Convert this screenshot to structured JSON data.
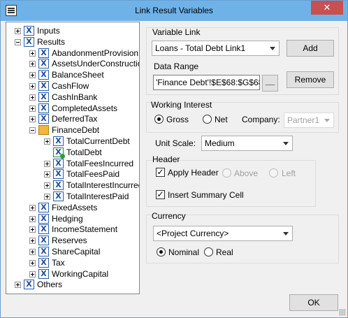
{
  "window": {
    "title": "Link Result Variables",
    "close_symbol": "✕"
  },
  "tree": [
    {
      "label": "Inputs",
      "icon": "variables-icon",
      "expander": "plus"
    },
    {
      "label": "Results",
      "icon": "variables-icon",
      "expander": "minus"
    },
    {
      "label": "AbandonmentProvision",
      "icon": "excel-icon",
      "expander": "plus"
    },
    {
      "label": "AssetsUnderConstruction",
      "icon": "excel-icon",
      "expander": "plus"
    },
    {
      "label": "BalanceSheet",
      "icon": "excel-icon",
      "expander": "plus"
    },
    {
      "label": "CashFlow",
      "icon": "excel-icon",
      "expander": "plus"
    },
    {
      "label": "CashInBank",
      "icon": "excel-icon",
      "expander": "plus"
    },
    {
      "label": "CompletedAssets",
      "icon": "excel-icon",
      "expander": "plus"
    },
    {
      "label": "DeferredTax",
      "icon": "excel-icon",
      "expander": "plus"
    },
    {
      "label": "FinanceDebt",
      "icon": "folder-icon",
      "expander": "minus"
    },
    {
      "label": "TotalCurrentDebt",
      "icon": "excel-icon",
      "expander": "plus"
    },
    {
      "label": "TotalDebt",
      "icon": "linked-excel-icon",
      "expander": "none"
    },
    {
      "label": "TotalFeesIncurred",
      "icon": "excel-icon",
      "expander": "plus"
    },
    {
      "label": "TotalFeesPaid",
      "icon": "excel-icon",
      "expander": "plus"
    },
    {
      "label": "TotalInterestIncurred",
      "icon": "excel-icon",
      "expander": "plus"
    },
    {
      "label": "TotalInterestPaid",
      "icon": "excel-icon",
      "expander": "plus"
    },
    {
      "label": "FixedAssets",
      "icon": "excel-icon",
      "expander": "plus"
    },
    {
      "label": "Hedging",
      "icon": "excel-icon",
      "expander": "plus"
    },
    {
      "label": "IncomeStatement",
      "icon": "excel-icon",
      "expander": "plus"
    },
    {
      "label": "Reserves",
      "icon": "excel-icon",
      "expander": "plus"
    },
    {
      "label": "ShareCapital",
      "icon": "excel-icon",
      "expander": "plus"
    },
    {
      "label": "Tax",
      "icon": "excel-icon",
      "expander": "plus"
    },
    {
      "label": "WorkingCapital",
      "icon": "excel-icon",
      "expander": "plus"
    },
    {
      "label": "Others",
      "icon": "others-icon",
      "expander": "plus"
    }
  ],
  "variable_link": {
    "label": "Variable Link",
    "selected": "Loans - Total Debt Link1",
    "add_label": "Add",
    "data_range_label": "Data Range",
    "data_range_value": "'Finance Debt'!$E$68:$G$68",
    "browse_label": "__",
    "remove_label": "Remove"
  },
  "working_interest": {
    "label": "Working Interest",
    "gross_label": "Gross",
    "net_label": "Net",
    "company_label": "Company:",
    "company_value": "Partner1",
    "selected": "Gross"
  },
  "unit_scale": {
    "label": "Unit Scale:",
    "value": "Medium"
  },
  "header": {
    "label": "Header",
    "apply_header_label": "Apply Header",
    "apply_header_checked": true,
    "above_label": "Above",
    "left_label": "Left",
    "insert_summary_label": "Insert Summary Cell",
    "insert_summary_checked": true
  },
  "currency": {
    "label": "Currency",
    "value": "<Project Currency>",
    "nominal_label": "Nominal",
    "real_label": "Real",
    "selected": "Nominal"
  },
  "ok_label": "OK"
}
